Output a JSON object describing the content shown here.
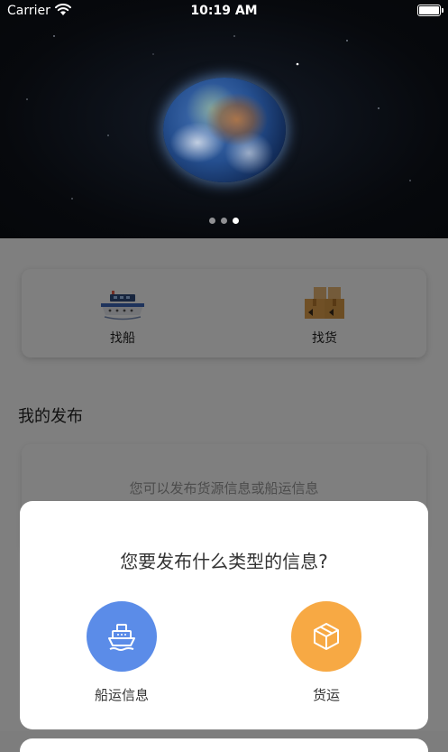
{
  "status_bar": {
    "carrier": "Carrier",
    "time": "10:19 AM"
  },
  "banner": {
    "page_count": 3,
    "active_page": 2
  },
  "quick_actions": [
    {
      "label": "找船",
      "icon": "cargo-ship-icon"
    },
    {
      "label": "找货",
      "icon": "cargo-boxes-icon"
    }
  ],
  "my_posts": {
    "title": "我的发布",
    "empty_text": "您可以发布货源信息或船运信息"
  },
  "dialog": {
    "title": "您要发布什么类型的信息?",
    "options": [
      {
        "label": "船运信息",
        "icon": "ship-icon",
        "color": "#5b8ce8"
      },
      {
        "label": "货运",
        "icon": "package-box-icon",
        "color": "#f7a944"
      }
    ]
  }
}
